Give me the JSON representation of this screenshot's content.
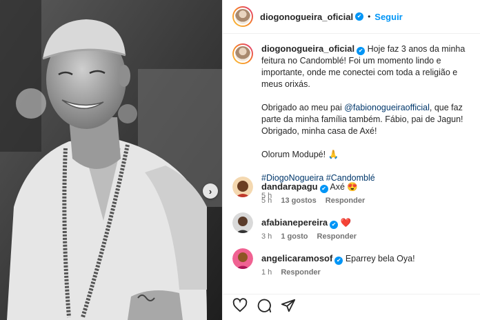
{
  "post": {
    "author": "diogonogueira_oficial",
    "dot": "•",
    "follow_label": "Seguir",
    "caption": {
      "p1": "Hoje faz 3 anos da minha feitura no Candomblé! Foi um momento lindo e importante, onde me conectei com toda a religião e meus orixás.",
      "p2_before": "Obrigado ao meu pai ",
      "p2_mention": "@fabionogueiraofficial",
      "p2_after": ", que faz parte da minha família também. Fábio, pai de Jagun! Obrigado, minha casa de Axé!",
      "p3": "Olorum Modupé! 🙏",
      "hashtags": "#DiogoNogueira #Candomblé",
      "time": "5 h"
    }
  },
  "comments": [
    {
      "user": "dandarapagu",
      "text": "Axé 😍",
      "time": "5 h",
      "likes": "13 gostos",
      "reply": "Responder"
    },
    {
      "user": "afabianepereira",
      "text": "❤️",
      "time": "3 h",
      "likes": "1 gosto",
      "reply": "Responder"
    },
    {
      "user": "angelicaramosof",
      "text": "Eparrey bela Oya!",
      "time": "1 h",
      "reply": "Responder"
    }
  ],
  "icons": [
    "heart-icon",
    "comment-icon",
    "share-icon",
    "verified-icon",
    "chevron-right-icon"
  ],
  "colors": {
    "link_blue": "#0095f6",
    "hashtag": "#00376b",
    "muted": "#737373"
  }
}
